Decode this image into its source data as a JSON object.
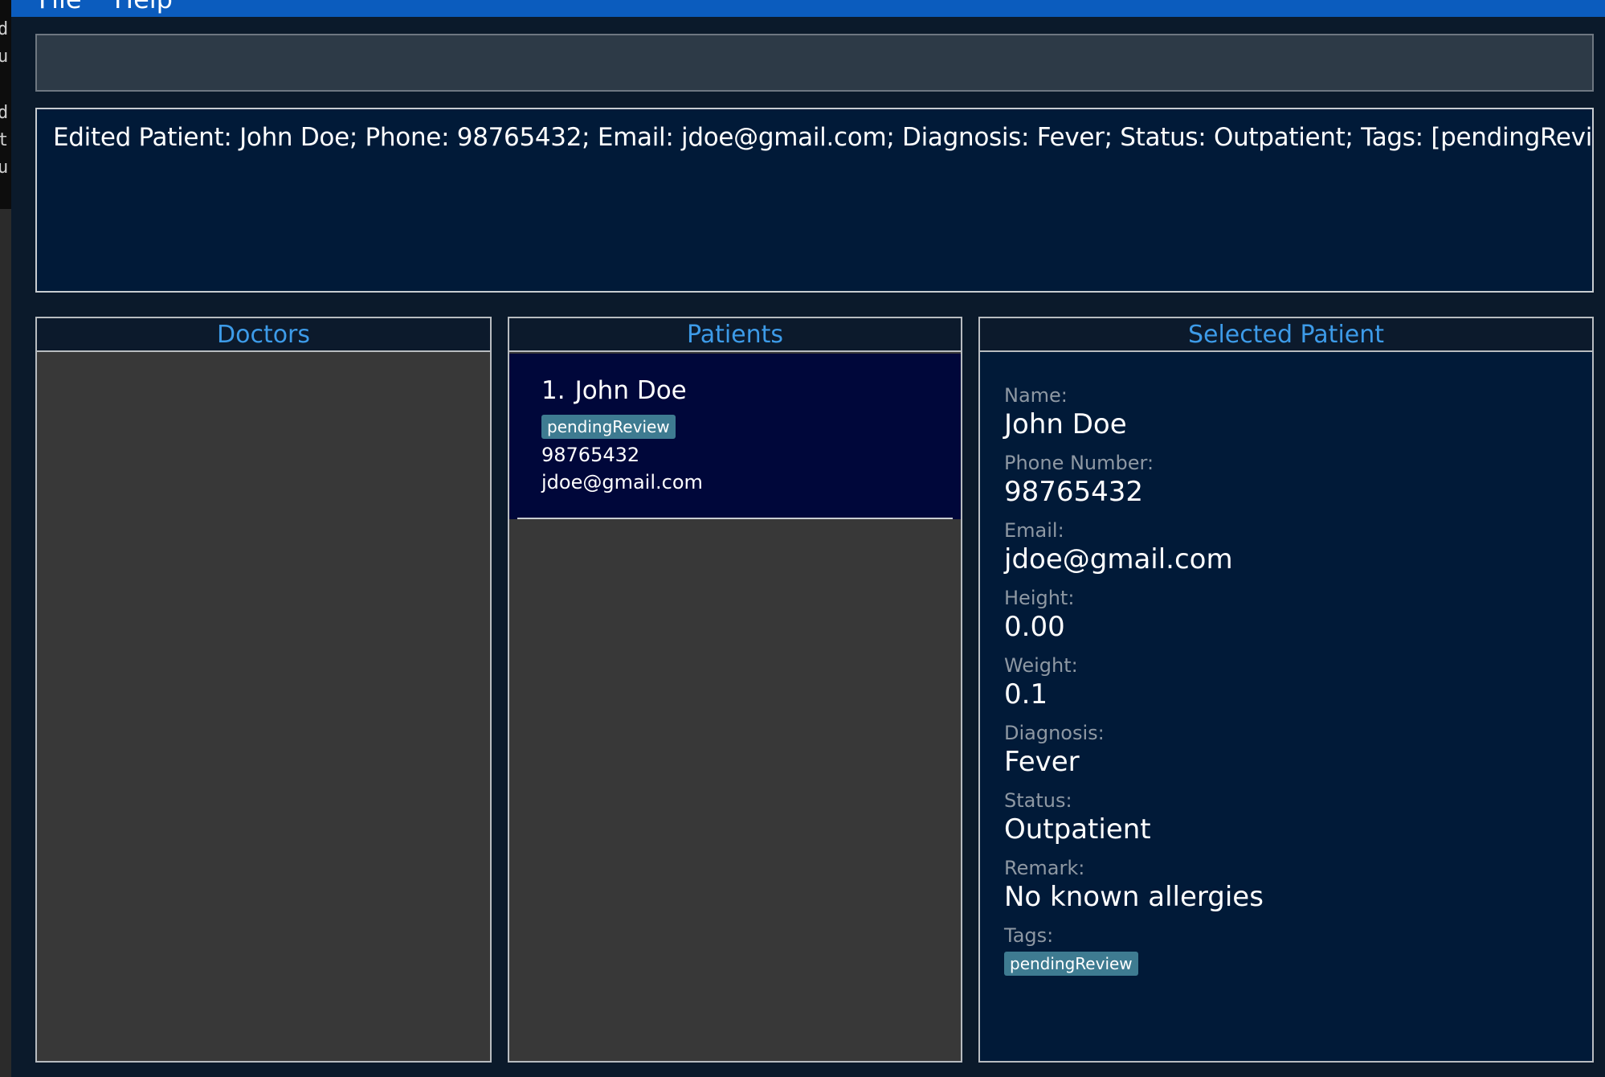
{
  "menu": {
    "file": "File",
    "help": "Help"
  },
  "side_glyphs": [
    "d",
    "u",
    "d",
    "t",
    "u"
  ],
  "command_box": {
    "value": ""
  },
  "result": {
    "message": "Edited Patient: John Doe; Phone: 98765432; Email: jdoe@gmail.com; Diagnosis: Fever; Status: Outpatient; Tags: [pendingReview]"
  },
  "panels": {
    "doctors_title": "Doctors",
    "patients_title": "Patients",
    "selected_title": "Selected Patient"
  },
  "patients": [
    {
      "index": "1.",
      "name": "John Doe",
      "tag": "pendingReview",
      "phone": "98765432",
      "email": "jdoe@gmail.com"
    }
  ],
  "selected": {
    "name_label": "Name:",
    "name": "John Doe",
    "phone_label": "Phone Number:",
    "phone": "98765432",
    "email_label": "Email:",
    "email": "jdoe@gmail.com",
    "height_label": "Height:",
    "height": "0.00",
    "weight_label": "Weight:",
    "weight": "0.1",
    "diagnosis_label": "Diagnosis:",
    "diagnosis": "Fever",
    "status_label": "Status:",
    "status": "Outpatient",
    "remark_label": "Remark:",
    "remark": "No known allergies",
    "tags_label": "Tags:",
    "tag": "pendingReview"
  },
  "colors": {
    "menubar": "#0b5cbe",
    "panel_title": "#3d9be8",
    "tag_bg": "#3e7b91",
    "card_bg": "#00073a",
    "detail_bg": "#011a38"
  }
}
